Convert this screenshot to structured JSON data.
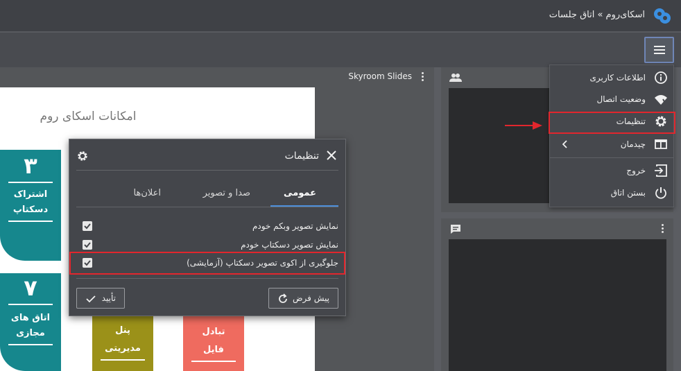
{
  "header": {
    "breadcrumb": "اسکای‌روم » اتاق جلسات",
    "logo_icon": "skyroom-logo-icon",
    "brand_color": "#3b8fe0"
  },
  "toolbar": {
    "menu_icon": "hamburger-menu-icon"
  },
  "slides_panel": {
    "title": "Skyroom Slides",
    "slide": {
      "heading": "امکانات اسکای روم",
      "tiles": [
        {
          "number": "۳",
          "label_line1": "اشتراک",
          "label_line2": "دسکتاپ"
        },
        {
          "number": "۷",
          "label_line1": "اتاق های",
          "label_line2": "مجازی"
        },
        {
          "number": "",
          "label_line1": "پنل",
          "label_line2": "مدیریتی"
        },
        {
          "number": "",
          "label_line1": "تبادل",
          "label_line2": "فایل"
        }
      ]
    }
  },
  "side_panels": {
    "users_icon": "users-icon",
    "chat_icon": "chat-icon"
  },
  "dropdown_menu": {
    "items": [
      {
        "label": "اطلاعات کاربری",
        "icon": "info-icon"
      },
      {
        "label": "وضعیت اتصال",
        "icon": "signal-icon"
      },
      {
        "label": "تنظیمات",
        "icon": "gear-icon"
      },
      {
        "label": "چیدمان",
        "icon": "layout-icon",
        "has_submenu": true
      },
      {
        "label": "خروج",
        "icon": "exit-icon"
      },
      {
        "label": "بستن اتاق",
        "icon": "power-icon"
      }
    ]
  },
  "settings_dialog": {
    "title": "تنظیمات",
    "tabs": [
      {
        "label": "عمومی",
        "active": true
      },
      {
        "label": "صدا و تصویر",
        "active": false
      },
      {
        "label": "اعلان‌ها",
        "active": false
      }
    ],
    "options": [
      {
        "label": "نمایش تصویر وبکم خودم",
        "checked": true
      },
      {
        "label": "نمایش تصویر دسکتاپ خودم",
        "checked": true
      },
      {
        "label": "جلوگیری از اکوی تصویر دسکتاپ (آزمایشی)",
        "checked": true
      }
    ],
    "reset_label": "پیش فرض",
    "confirm_label": "تأیید"
  },
  "highlight_color": "#e2262d"
}
